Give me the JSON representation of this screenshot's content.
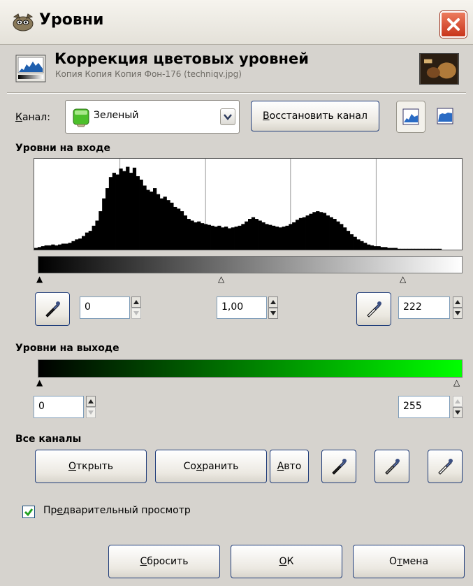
{
  "window": {
    "title": "Уровни"
  },
  "header": {
    "title": "Коррекция цветовых уровней",
    "subtitle": "Копия Копия Копия Фон-176 (techniqv.jpg)"
  },
  "channel": {
    "label_prefix": "",
    "label_accel": "К",
    "label_rest": "анал:",
    "value": "Зеленый",
    "value_color": "#3fa21e",
    "reset_button_accel": "В",
    "reset_button_rest": "осстановить канал"
  },
  "input_levels": {
    "heading": "Уровни на входе",
    "low": "0",
    "gamma": "1,00",
    "high": "222",
    "histogram_bars": [
      2,
      3,
      4,
      5,
      5,
      6,
      5,
      6,
      7,
      7,
      8,
      10,
      12,
      13,
      16,
      20,
      22,
      28,
      34,
      45,
      60,
      72,
      85,
      90,
      88,
      95,
      92,
      97,
      90,
      96,
      86,
      82,
      75,
      70,
      68,
      72,
      65,
      60,
      62,
      58,
      55,
      50,
      48,
      45,
      40,
      36,
      34,
      32,
      33,
      31,
      30,
      29,
      28,
      27,
      28,
      26,
      27,
      25,
      26,
      27,
      28,
      30,
      33,
      36,
      38,
      36,
      34,
      32,
      30,
      29,
      28,
      27,
      26,
      27,
      28,
      30,
      32,
      35,
      37,
      38,
      40,
      42,
      44,
      45,
      44,
      43,
      40,
      38,
      36,
      33,
      30,
      26,
      22,
      18,
      15,
      12,
      10,
      8,
      6,
      5,
      4,
      4,
      3,
      3,
      2,
      2,
      2,
      1,
      1,
      1,
      1,
      1,
      1,
      1,
      1,
      1,
      1,
      1,
      1,
      1,
      0,
      0,
      0,
      0,
      0,
      0
    ],
    "histogram_max": 100
  },
  "output_levels": {
    "heading": "Уровни на выходе",
    "low": "0",
    "high": "255",
    "gradient_color": "#00ff00"
  },
  "all_channels": {
    "heading": "Все каналы",
    "open_accel": "О",
    "open_rest": "ткрыть",
    "save_pre": "Со",
    "save_accel": "х",
    "save_rest": "ранить",
    "auto_accel": "А",
    "auto_rest": "вто"
  },
  "preview": {
    "checked": true,
    "label_pre": "Пр",
    "label_accel": "е",
    "label_rest": "дварительный просмотр"
  },
  "footer": {
    "reset_accel": "С",
    "reset_rest": "бросить",
    "ok_accel": "О",
    "ok_rest": "К",
    "cancel_pre": "О",
    "cancel_accel": "т",
    "cancel_rest": "мена"
  }
}
